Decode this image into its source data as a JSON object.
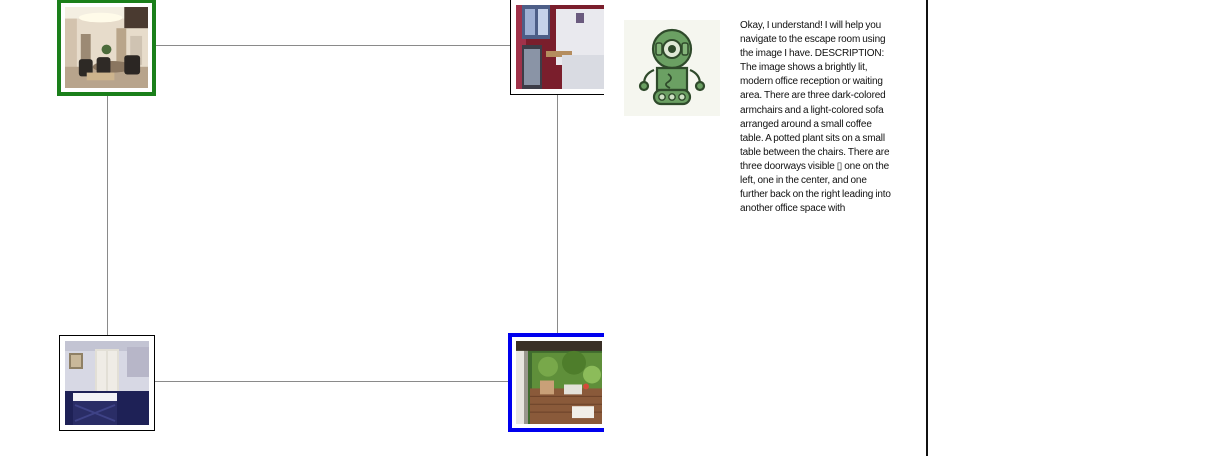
{
  "map": {
    "rooms": [
      {
        "id": "reception",
        "icon": "reception-room-photo",
        "state": "current",
        "accent": "#1a7f1a"
      },
      {
        "id": "kitchen",
        "icon": "kitchen-room-photo",
        "state": "normal"
      },
      {
        "id": "bedroom",
        "icon": "bedroom-room-photo",
        "state": "normal"
      },
      {
        "id": "porch",
        "icon": "porch-room-photo",
        "state": "goal",
        "accent": "#0000ee"
      }
    ],
    "connections": [
      [
        "reception",
        "kitchen"
      ],
      [
        "reception",
        "bedroom"
      ],
      [
        "kitchen",
        "porch"
      ],
      [
        "bedroom",
        "porch"
      ]
    ]
  },
  "assistant": {
    "avatar_icon": "robot-icon",
    "message": "Okay, I understand! I will help you navigate to the escape room using the image I have.  DESCRIPTION: The image shows a brightly lit, modern office reception or waiting area. There are three dark-colored armchairs and a light-colored sofa arranged around a small coffee table. A potted plant sits on a small table between the chairs. There are three doorways visible ▯ one on the left, one in the center, and one further back on the right leading into another office space with"
  },
  "colors": {
    "current_room": "#1a7f1a",
    "goal_room": "#0000ee",
    "robot": "#5f9a58"
  }
}
